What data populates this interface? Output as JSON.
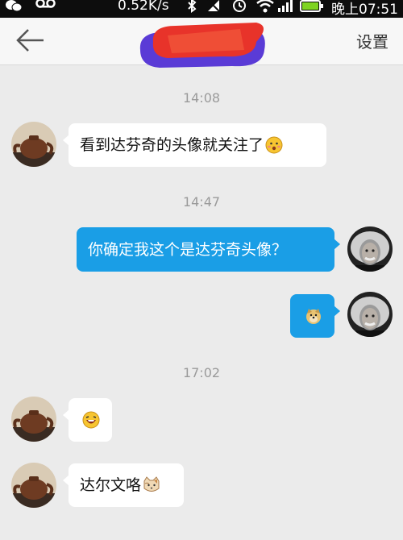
{
  "status_bar": {
    "network_speed": "0.52K/s",
    "time": "晚上07:51"
  },
  "header": {
    "back_icon": "arrow-left-icon",
    "settings_label": "设置"
  },
  "messages": [
    {
      "type": "timestamp",
      "text": "14:08"
    },
    {
      "type": "received",
      "text": "看到达芬奇的头像就关注了",
      "emoji": "smiley-blush"
    },
    {
      "type": "timestamp",
      "text": "14:47"
    },
    {
      "type": "sent",
      "text": "你确定我这个是达芬奇头像？"
    },
    {
      "type": "sent",
      "emoji": "doge"
    },
    {
      "type": "timestamp",
      "text": "17:02"
    },
    {
      "type": "received",
      "emoji": "laughing-face"
    },
    {
      "type": "received",
      "text": "达尔文咯",
      "emoji": "cat-face"
    }
  ]
}
